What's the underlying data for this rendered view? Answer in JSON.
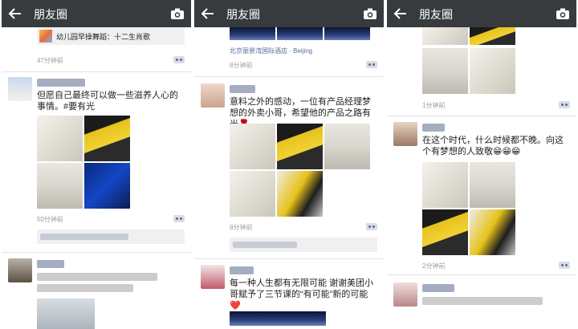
{
  "nav": {
    "title": "朋友圈"
  },
  "screen1": {
    "post0": {
      "link_text": "幼儿园早操舞蹈：十二生肖歌",
      "time": "47分钟前"
    },
    "post1": {
      "text": "但愿自己最终可以做一些滋养人心的事情。#要有光",
      "time": "50分钟前"
    }
  },
  "screen2": {
    "post0": {
      "location": "北京丽景湾国际酒店 · Beijing",
      "time": "8分钟前"
    },
    "post1": {
      "text": "意料之外的感动，一位有产品经理梦想的外卖小哥，希望他的产品之路有光🌹",
      "time": "8分钟前"
    },
    "post2": {
      "text": "每一种人生都有无限可能 谢谢美团小哥赋予了三节课的“有可能”新的可能❤️"
    }
  },
  "screen3": {
    "post0": {
      "time": "1分钟前"
    },
    "post1": {
      "text": "在这个时代，什么时候都不晚。向这个有梦想的人致敬😁😁😁",
      "time": "2分钟前"
    }
  }
}
